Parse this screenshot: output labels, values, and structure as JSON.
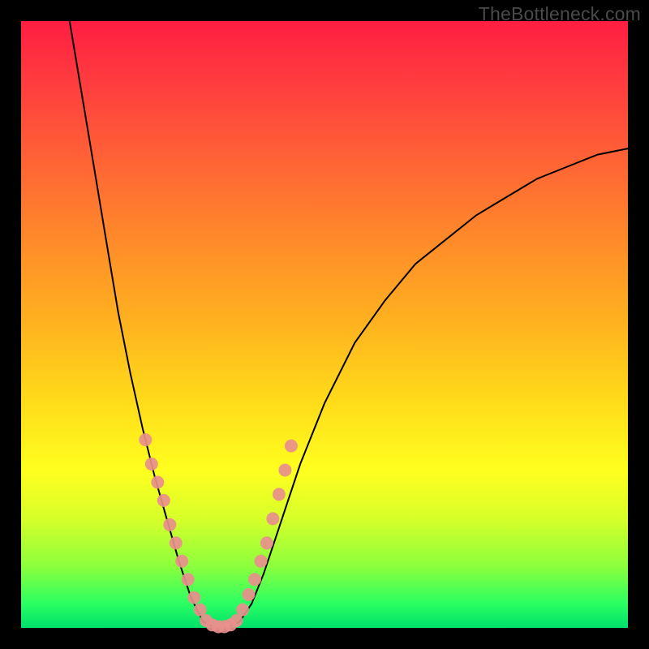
{
  "watermark": "TheBottleneck.com",
  "chart_data": {
    "type": "line",
    "title": "",
    "xlabel": "",
    "ylabel": "",
    "xlim": [
      0,
      100
    ],
    "ylim": [
      0,
      100
    ],
    "grid": false,
    "legend": false,
    "curve": {
      "name": "bottleneck-curve",
      "points": [
        {
          "x": 8,
          "y": 100
        },
        {
          "x": 10,
          "y": 88
        },
        {
          "x": 12,
          "y": 76
        },
        {
          "x": 14,
          "y": 64
        },
        {
          "x": 16,
          "y": 52
        },
        {
          "x": 18,
          "y": 42
        },
        {
          "x": 20,
          "y": 33
        },
        {
          "x": 22,
          "y": 25
        },
        {
          "x": 24,
          "y": 18
        },
        {
          "x": 26,
          "y": 11
        },
        {
          "x": 28,
          "y": 5
        },
        {
          "x": 30,
          "y": 1
        },
        {
          "x": 32,
          "y": 0
        },
        {
          "x": 34,
          "y": 0
        },
        {
          "x": 36,
          "y": 1
        },
        {
          "x": 38,
          "y": 4
        },
        {
          "x": 40,
          "y": 9
        },
        {
          "x": 42,
          "y": 15
        },
        {
          "x": 44,
          "y": 21
        },
        {
          "x": 46,
          "y": 27
        },
        {
          "x": 50,
          "y": 37
        },
        {
          "x": 55,
          "y": 47
        },
        {
          "x": 60,
          "y": 54
        },
        {
          "x": 65,
          "y": 60
        },
        {
          "x": 70,
          "y": 64
        },
        {
          "x": 75,
          "y": 68
        },
        {
          "x": 80,
          "y": 71
        },
        {
          "x": 85,
          "y": 74
        },
        {
          "x": 90,
          "y": 76
        },
        {
          "x": 95,
          "y": 78
        },
        {
          "x": 100,
          "y": 79
        }
      ]
    },
    "highlight_points": {
      "name": "sample-dots",
      "color": "#e88f8c",
      "points": [
        {
          "x": 20.5,
          "y": 31
        },
        {
          "x": 21.5,
          "y": 27
        },
        {
          "x": 22.5,
          "y": 24
        },
        {
          "x": 23.5,
          "y": 21
        },
        {
          "x": 24.5,
          "y": 17
        },
        {
          "x": 25.5,
          "y": 14
        },
        {
          "x": 26.5,
          "y": 11
        },
        {
          "x": 27.5,
          "y": 8
        },
        {
          "x": 28.5,
          "y": 5
        },
        {
          "x": 29.5,
          "y": 3
        },
        {
          "x": 30.5,
          "y": 1.2
        },
        {
          "x": 31.5,
          "y": 0.5
        },
        {
          "x": 32.5,
          "y": 0.2
        },
        {
          "x": 33.5,
          "y": 0.2
        },
        {
          "x": 34.5,
          "y": 0.5
        },
        {
          "x": 35.5,
          "y": 1.2
        },
        {
          "x": 36.5,
          "y": 3
        },
        {
          "x": 37.5,
          "y": 5.5
        },
        {
          "x": 38.5,
          "y": 8
        },
        {
          "x": 39.5,
          "y": 11
        },
        {
          "x": 40.5,
          "y": 14
        },
        {
          "x": 41.5,
          "y": 18
        },
        {
          "x": 42.5,
          "y": 22
        },
        {
          "x": 43.5,
          "y": 26
        },
        {
          "x": 44.5,
          "y": 30
        }
      ]
    }
  }
}
